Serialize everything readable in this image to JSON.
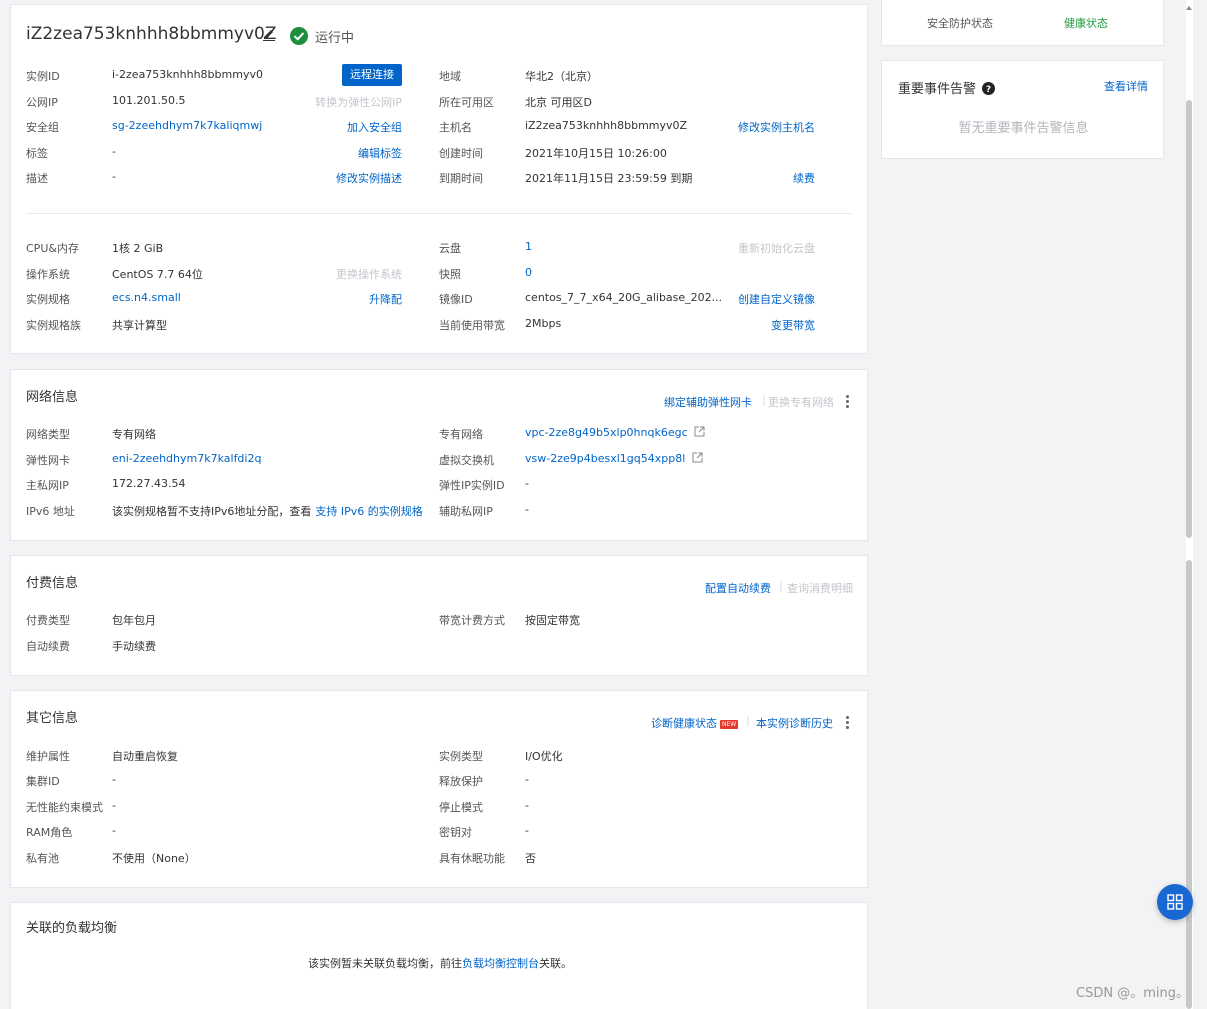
{
  "header": {
    "instance_name": "iZ2zea753knhhh8bbmmyv0Z",
    "status": "运行中"
  },
  "basic": {
    "rows": [
      {
        "label": "实例ID",
        "value": "i-2zea753knhhh8bbmmyv0",
        "action": "远程连接",
        "r_label": "地域",
        "r_value": "华北2（北京）",
        "r_action": ""
      },
      {
        "label": "公网IP",
        "value": "101.201.50.5",
        "action": "转换为弹性公网IP",
        "r_label": "所在可用区",
        "r_value": "北京 可用区D",
        "r_action": ""
      },
      {
        "label": "安全组",
        "value": "sg-2zeehdhym7k7kaliqmwj",
        "action": "加入安全组",
        "r_label": "主机名",
        "r_value": "iZ2zea753knhhh8bbmmyv0Z",
        "r_action": "修改实例主机名"
      },
      {
        "label": "标签",
        "value": "-",
        "action": "编辑标签",
        "r_label": "创建时间",
        "r_value": "2021年10月15日 10:26:00",
        "r_action": ""
      },
      {
        "label": "描述",
        "value": "-",
        "action": "修改实例描述",
        "r_label": "到期时间",
        "r_value": "2021年11月15日 23:59:59 到期",
        "r_action": "续费"
      }
    ],
    "rows2": [
      {
        "label": "CPU&内存",
        "value": "1核 2 GiB",
        "action": "",
        "r_label": "云盘",
        "r_value": "1",
        "r_action": "重新初始化云盘"
      },
      {
        "label": "操作系统",
        "value": "CentOS 7.7 64位",
        "action": "更换操作系统",
        "r_label": "快照",
        "r_value": "0",
        "r_action": ""
      },
      {
        "label": "实例规格",
        "value": "ecs.n4.small",
        "action": "升降配",
        "r_label": "镜像ID",
        "r_value": "centos_7_7_x64_20G_alibase_202...",
        "r_action": "创建自定义镜像"
      },
      {
        "label": "实例规格族",
        "value": "共享计算型",
        "action": "",
        "r_label": "当前使用带宽",
        "r_value": "2Mbps",
        "r_action": "变更带宽"
      }
    ]
  },
  "network": {
    "title": "网络信息",
    "action1": "绑定辅助弹性网卡",
    "action2": "更换专有网络",
    "rows": [
      {
        "label": "网络类型",
        "value": "专有网络",
        "r_label": "专有网络",
        "r_value": "vpc-2ze8g49b5xlp0hnqk6egc"
      },
      {
        "label": "弹性网卡",
        "value": "eni-2zeehdhym7k7kalfdi2q",
        "r_label": "虚拟交换机",
        "r_value": "vsw-2ze9p4besxl1gq54xpp8l"
      },
      {
        "label": "主私网IP",
        "value": "172.27.43.54",
        "r_label": "弹性IP实例ID",
        "r_value": "-"
      },
      {
        "label": "IPv6 地址",
        "value": "该实例规格暂不支持IPv6地址分配，查看",
        "value_link": "支持 IPv6 的实例规格",
        "r_label": "辅助私网IP",
        "r_value": "-"
      }
    ]
  },
  "billing": {
    "title": "付费信息",
    "action1": "配置自动续费",
    "action2": "查询消费明细",
    "rows": [
      {
        "label": "付费类型",
        "value": "包年包月",
        "r_label": "带宽计费方式",
        "r_value": "按固定带宽"
      },
      {
        "label": "自动续费",
        "value": "手动续费",
        "r_label": "",
        "r_value": ""
      }
    ]
  },
  "other": {
    "title": "其它信息",
    "action1": "诊断健康状态",
    "badge": "NEW",
    "action2": "本实例诊断历史",
    "rows": [
      {
        "label": "维护属性",
        "value": "自动重启恢复",
        "r_label": "实例类型",
        "r_value": "I/O优化"
      },
      {
        "label": "集群ID",
        "value": "-",
        "r_label": "释放保护",
        "r_value": "-"
      },
      {
        "label": "无性能约束模式",
        "value": "-",
        "r_label": "停止模式",
        "r_value": "-"
      },
      {
        "label": "RAM角色",
        "value": "-",
        "r_label": "密钥对",
        "r_value": "-"
      },
      {
        "label": "私有池",
        "value": "不使用（None）",
        "r_label": "具有休眠功能",
        "r_value": "否"
      }
    ]
  },
  "lb": {
    "title": "关联的负载均衡",
    "text_before": "该实例暂未关联负载均衡，前往",
    "link": "负载均衡控制台",
    "text_after": "关联。"
  },
  "side": {
    "protect_label": "安全防护状态",
    "health_label": "健康状态",
    "events_title": "重要事件告警",
    "events_link": "查看详情",
    "events_empty": "暂无重要事件告警信息"
  },
  "watermark": "CSDN @。ming。",
  "colors": {
    "link": "#0064c8",
    "primary": "#0064c8",
    "success": "#1e8e3e",
    "green_text": "#1e9a3d"
  }
}
